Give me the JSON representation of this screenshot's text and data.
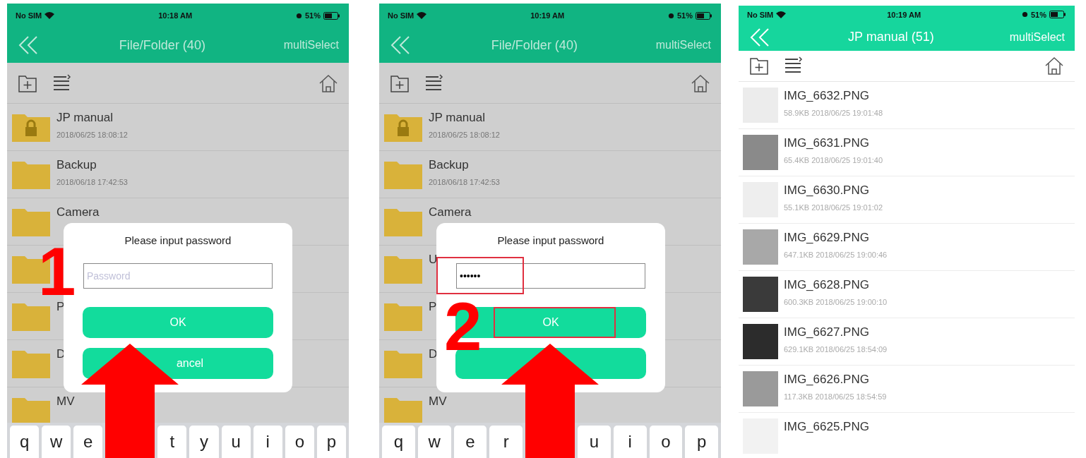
{
  "screens": [
    {
      "dimmed": true,
      "status_bar": {
        "carrier": "No SIM",
        "time": "10:18 AM",
        "battery": "51%"
      },
      "nav": {
        "title": "File/Folder (40)",
        "action": "multiSelect"
      },
      "rows": [
        {
          "name": "JP manual",
          "date": "2018/06/25 18:08:12",
          "locked": true
        },
        {
          "name": "Backup",
          "date": "2018/06/18 17:42:53",
          "locked": false
        },
        {
          "name": "Camera",
          "locked": false
        },
        {
          "locked": false
        },
        {
          "name": "P",
          "locked": false
        },
        {
          "name": "D",
          "locked": false
        },
        {
          "name": "MV",
          "locked": false
        }
      ],
      "dialog": {
        "title": "Please input password",
        "input": {
          "placeholder": "Password",
          "highlighted": false
        },
        "buttons": [
          {
            "label": "OK",
            "highlighted": false
          },
          {
            "label": "ancel",
            "highlighted": false
          }
        ]
      },
      "keyboard": [
        {
          "label": "q"
        },
        {
          "label": "w"
        },
        {
          "label": "e"
        },
        {
          "label": "t"
        },
        {
          "label": "y"
        },
        {
          "label": "u"
        },
        {
          "label": "i"
        },
        {
          "label": "o"
        },
        {
          "label": "p"
        }
      ],
      "step": "1"
    },
    {
      "dimmed": true,
      "status_bar": {
        "carrier": "No SIM",
        "time": "10:19 AM",
        "battery": "51%"
      },
      "nav": {
        "title": "File/Folder (40)",
        "action": "multiSelect"
      },
      "rows": [
        {
          "name": "JP manual",
          "date": "2018/06/25 18:08:12",
          "locked": true
        },
        {
          "name": "Backup",
          "date": "2018/06/18 17:42:53",
          "locked": false
        },
        {
          "name": "Camera",
          "locked": false
        },
        {
          "name": "U",
          "locked": false
        },
        {
          "name": "P",
          "locked": false
        },
        {
          "name": "D",
          "locked": false
        },
        {
          "name": "MV",
          "locked": false
        }
      ],
      "dialog": {
        "title": "Please input password",
        "input": {
          "value": "••••••",
          "highlighted": true
        },
        "buttons": [
          {
            "label": "OK",
            "highlighted": true
          },
          {
            "highlighted": false
          }
        ]
      },
      "keyboard": [
        {
          "label": "q"
        },
        {
          "label": "w"
        },
        {
          "label": "e"
        },
        {
          "label": "r"
        },
        {
          "label": "u"
        },
        {
          "label": "i"
        },
        {
          "label": "o"
        },
        {
          "label": "p"
        }
      ],
      "step": "2"
    },
    {
      "dimmed": false,
      "status_bar": {
        "carrier": "No SIM",
        "time": "10:19 AM",
        "battery": "51%"
      },
      "nav": {
        "title": "JP manual (51)",
        "action": "multiSelect"
      },
      "rows": [
        {
          "name": "IMG_6632.PNG",
          "date": "58.9KB 2018/06/25 19:01:48",
          "kind": "image"
        },
        {
          "name": "IMG_6631.PNG",
          "date": "65.4KB 2018/06/25 19:01:40",
          "kind": "image"
        },
        {
          "name": "IMG_6630.PNG",
          "date": "55.1KB 2018/06/25 19:01:02",
          "kind": "image"
        },
        {
          "name": "IMG_6629.PNG",
          "date": "647.1KB 2018/06/25 19:00:46",
          "kind": "image"
        },
        {
          "name": "IMG_6628.PNG",
          "date": "600.3KB 2018/06/25 19:00:10",
          "kind": "image"
        },
        {
          "name": "IMG_6627.PNG",
          "date": "629.1KB 2018/06/25 18:54:09",
          "kind": "image"
        },
        {
          "name": "IMG_6626.PNG",
          "date": "117.3KB 2018/06/25 18:54:59",
          "kind": "image"
        },
        {
          "name": "IMG_6625.PNG",
          "kind": "image"
        }
      ]
    }
  ]
}
